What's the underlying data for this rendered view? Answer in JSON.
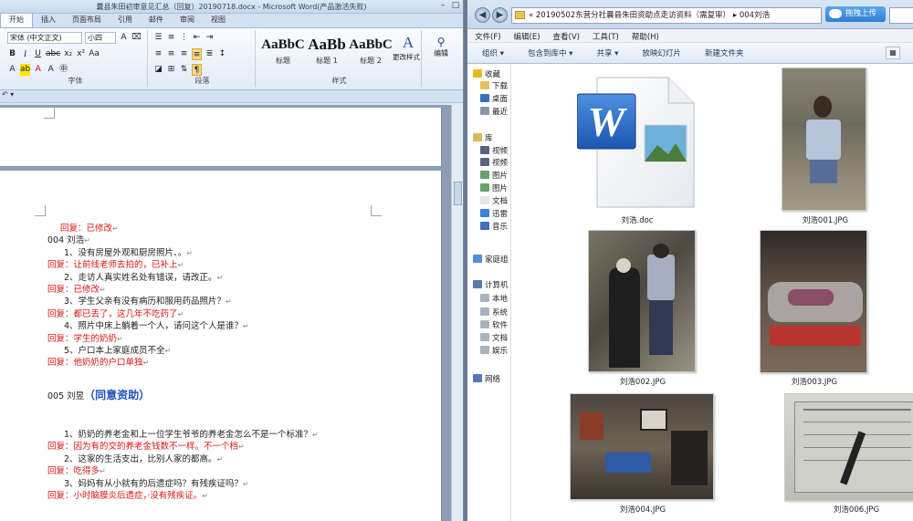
{
  "word": {
    "title": "曩县朱田初审意见汇总（回复）20190718.docx - Microsoft Word(产品激活失败)",
    "tabs": [
      "开始",
      "插入",
      "页面布局",
      "引用",
      "邮件",
      "审阅",
      "视图"
    ],
    "font_name": "宋体 (中文正文)",
    "font_size": "小四",
    "groups": [
      "字体",
      "段落",
      "样式",
      "编辑"
    ],
    "styles": [
      {
        "sample": "AaBbC",
        "name": "标题"
      },
      {
        "sample": "AaBb",
        "name": "标题 1"
      },
      {
        "sample": "AaBbC",
        "name": "标题 2"
      }
    ],
    "change_styles": "更改样式",
    "edit": "编辑",
    "doc_lines": [
      {
        "text": "回复：已修改",
        "color": "red",
        "indent": "reply"
      },
      {
        "text": "004 刘浩",
        "color": "black",
        "indent": "none"
      },
      {
        "text": "1、没有房屋外观和厨房照片、。",
        "color": "black",
        "indent": "item"
      },
      {
        "text": "回复：让前线老师去拍的，已补上",
        "color": "red",
        "indent": "none"
      },
      {
        "text": "2、走访人真实姓名处有错误，请改正。",
        "color": "black",
        "indent": "item"
      },
      {
        "text": "回复：已修改",
        "color": "red",
        "indent": "none"
      },
      {
        "text": "3、学生父亲有没有病历和服用药品照片？",
        "color": "black",
        "indent": "item"
      },
      {
        "text": "回复：都已丢了，这几年不吃药了",
        "color": "red",
        "indent": "none"
      },
      {
        "text": "4、照片中床上躺着一个人，请问这个人是谁？",
        "color": "black",
        "indent": "item"
      },
      {
        "text": "回复：学生的奶奶",
        "color": "red",
        "indent": "none"
      },
      {
        "text": "5、户口本上家庭成员不全",
        "color": "black",
        "indent": "item"
      },
      {
        "text": "回复：他奶奶的户口单独",
        "color": "red",
        "indent": "none"
      }
    ],
    "case005_name": "005 刘昱",
    "case005_tag": "（同意资助）",
    "doc_lines2": [
      {
        "text": "1、奶奶的养老金和上一位学生爷爷的养老金怎么不是一个标准？",
        "color": "black",
        "indent": "item"
      },
      {
        "text": "回复：因为有的交的养老金钱数不一样。不一个档",
        "color": "red",
        "indent": "none"
      },
      {
        "text": "2、这家的生活支出，比别人家的都高。",
        "color": "black",
        "indent": "item"
      },
      {
        "text": "回复：吃得多",
        "color": "red",
        "indent": "none"
      },
      {
        "text": "3、妈妈有从小就有的后遗症吗？有残疾证吗？",
        "color": "black",
        "indent": "item"
      },
      {
        "text": "回复：小时脑膜炎后遗症，·没有残疾证。",
        "color": "red",
        "indent": "none"
      }
    ],
    "colors": {
      "red": "#e01414",
      "black": "#222222",
      "blue": "#1f4fbf"
    }
  },
  "explorer": {
    "breadcrumb": "«  20190502东营分社曩县朱田资助点走访资料（需复审）  ▸  004刘浩",
    "upload_label": "拖拽上传",
    "menu": [
      "文件(F)",
      "编辑(E)",
      "查看(V)",
      "工具(T)",
      "帮助(H)"
    ],
    "toolbar": [
      "组织 ▾",
      "包含到库中 ▾",
      "共享 ▾",
      "放映幻灯片",
      "新建文件夹"
    ],
    "nav": [
      {
        "label": "收藏",
        "icon": "star-icon"
      },
      {
        "label": "下载",
        "icon": "folder-icon"
      },
      {
        "label": "桌面",
        "icon": "desktop-icon"
      },
      {
        "label": "最近",
        "icon": "recent-icon"
      },
      {
        "label": "库",
        "icon": "library-icon"
      },
      {
        "label": "视频",
        "icon": "video-icon"
      },
      {
        "label": "视频",
        "icon": "video-icon"
      },
      {
        "label": "图片",
        "icon": "picture-icon"
      },
      {
        "label": "图片",
        "icon": "picture-icon"
      },
      {
        "label": "文档",
        "icon": "document-icon"
      },
      {
        "label": "迅雷",
        "icon": "thunder-icon"
      },
      {
        "label": "音乐",
        "icon": "music-icon"
      },
      {
        "label": "家庭组",
        "icon": "homegroup-icon"
      },
      {
        "label": "计算机",
        "icon": "computer-icon"
      },
      {
        "label": "本地",
        "icon": "drive-icon"
      },
      {
        "label": "系统",
        "icon": "drive-icon"
      },
      {
        "label": "软件",
        "icon": "drive-icon"
      },
      {
        "label": "文档",
        "icon": "drive-icon"
      },
      {
        "label": "娱乐",
        "icon": "drive-icon"
      },
      {
        "label": "网络",
        "icon": "network-icon"
      }
    ],
    "files": [
      {
        "name": "刘浩.doc",
        "kind": "doc"
      },
      {
        "name": "刘浩001.JPG",
        "kind": "photo"
      },
      {
        "name": "刘浩002.JPG",
        "kind": "photo"
      },
      {
        "name": "刘浩003.JPG",
        "kind": "photo"
      },
      {
        "name": "刘浩004.JPG",
        "kind": "photo"
      },
      {
        "name": "刘浩006.JPG",
        "kind": "photo"
      }
    ]
  }
}
